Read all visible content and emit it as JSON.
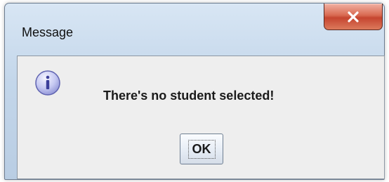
{
  "dialog": {
    "title": "Message",
    "message": "There's no student selected!",
    "ok_label": "OK",
    "icon": "info-icon",
    "close_icon": "close-icon"
  },
  "colors": {
    "close_button": "#c9503a",
    "content_background": "#eeeeee",
    "frame": "#c3d6ea"
  }
}
